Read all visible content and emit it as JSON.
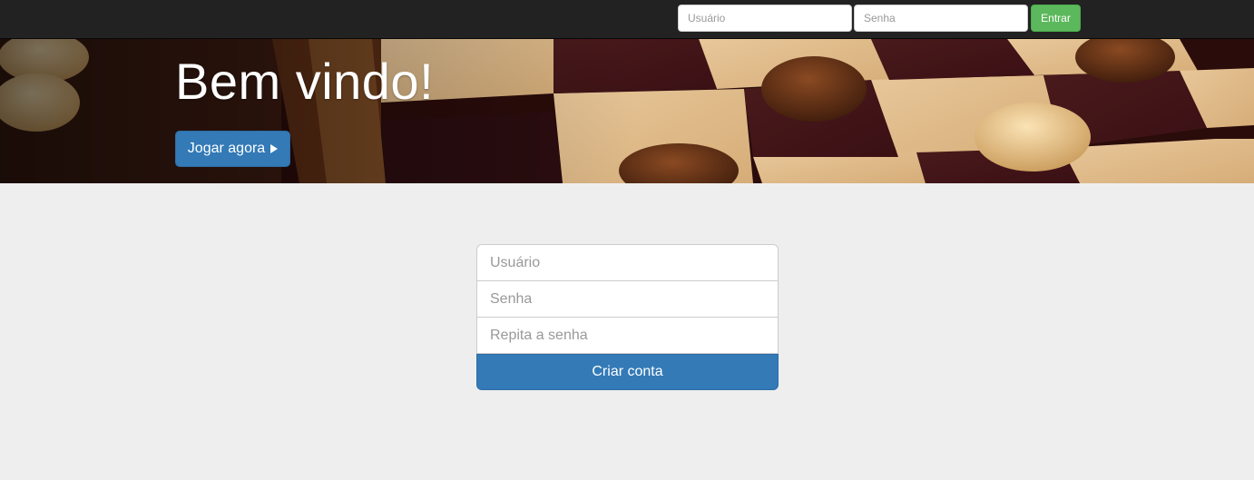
{
  "navbar": {
    "username_placeholder": "Usuário",
    "password_placeholder": "Senha",
    "login_label": "Entrar"
  },
  "hero": {
    "title": "Bem vindo!",
    "play_label": "Jogar agora"
  },
  "register": {
    "username_placeholder": "Usuário",
    "password_placeholder": "Senha",
    "repeat_password_placeholder": "Repita a senha",
    "submit_label": "Criar conta"
  },
  "colors": {
    "navbar_bg": "#222222",
    "login_button": "#5cb85c",
    "primary_button": "#337ab7",
    "page_bg": "#eeeeee"
  },
  "icons": {
    "play": "play-icon"
  }
}
